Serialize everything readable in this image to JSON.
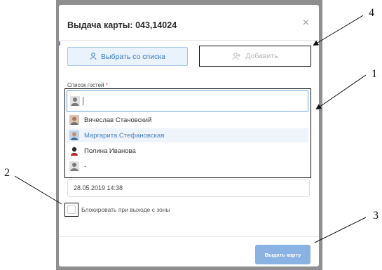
{
  "dialog": {
    "title": "Выдача карты: 043,14024",
    "close_glyph": "×",
    "tabs": [
      {
        "label": "Выбрать со списка",
        "icon": "user-icon",
        "active": true
      },
      {
        "label": "Добавить",
        "icon": "add-user-icon",
        "active": false
      }
    ],
    "guest_list_label": "Список гостей",
    "required_marker": "*",
    "options": [
      {
        "name": "Вячеслав Становский",
        "icon": "avatar-photo-icon"
      },
      {
        "name": "Маргарита Стефановская",
        "icon": "avatar-photo-icon",
        "highlighted": true
      },
      {
        "name": "Полина Иванова",
        "icon": "female-avatar-icon"
      },
      {
        "name": "-",
        "icon": "default-avatar-icon"
      }
    ],
    "datetime_value": "28.05.2019 14:38",
    "block_on_exit_label": "Блокировать при выходе с зоны",
    "block_on_exit_checked": false,
    "submit_label": "Выдать карту"
  },
  "callouts": [
    "1",
    "2",
    "3",
    "4"
  ],
  "colors": {
    "accent": "#3d7cc3",
    "submit_bg": "#8ab2e3",
    "backdrop": "#8f8f8f",
    "required": "#e0484b"
  }
}
